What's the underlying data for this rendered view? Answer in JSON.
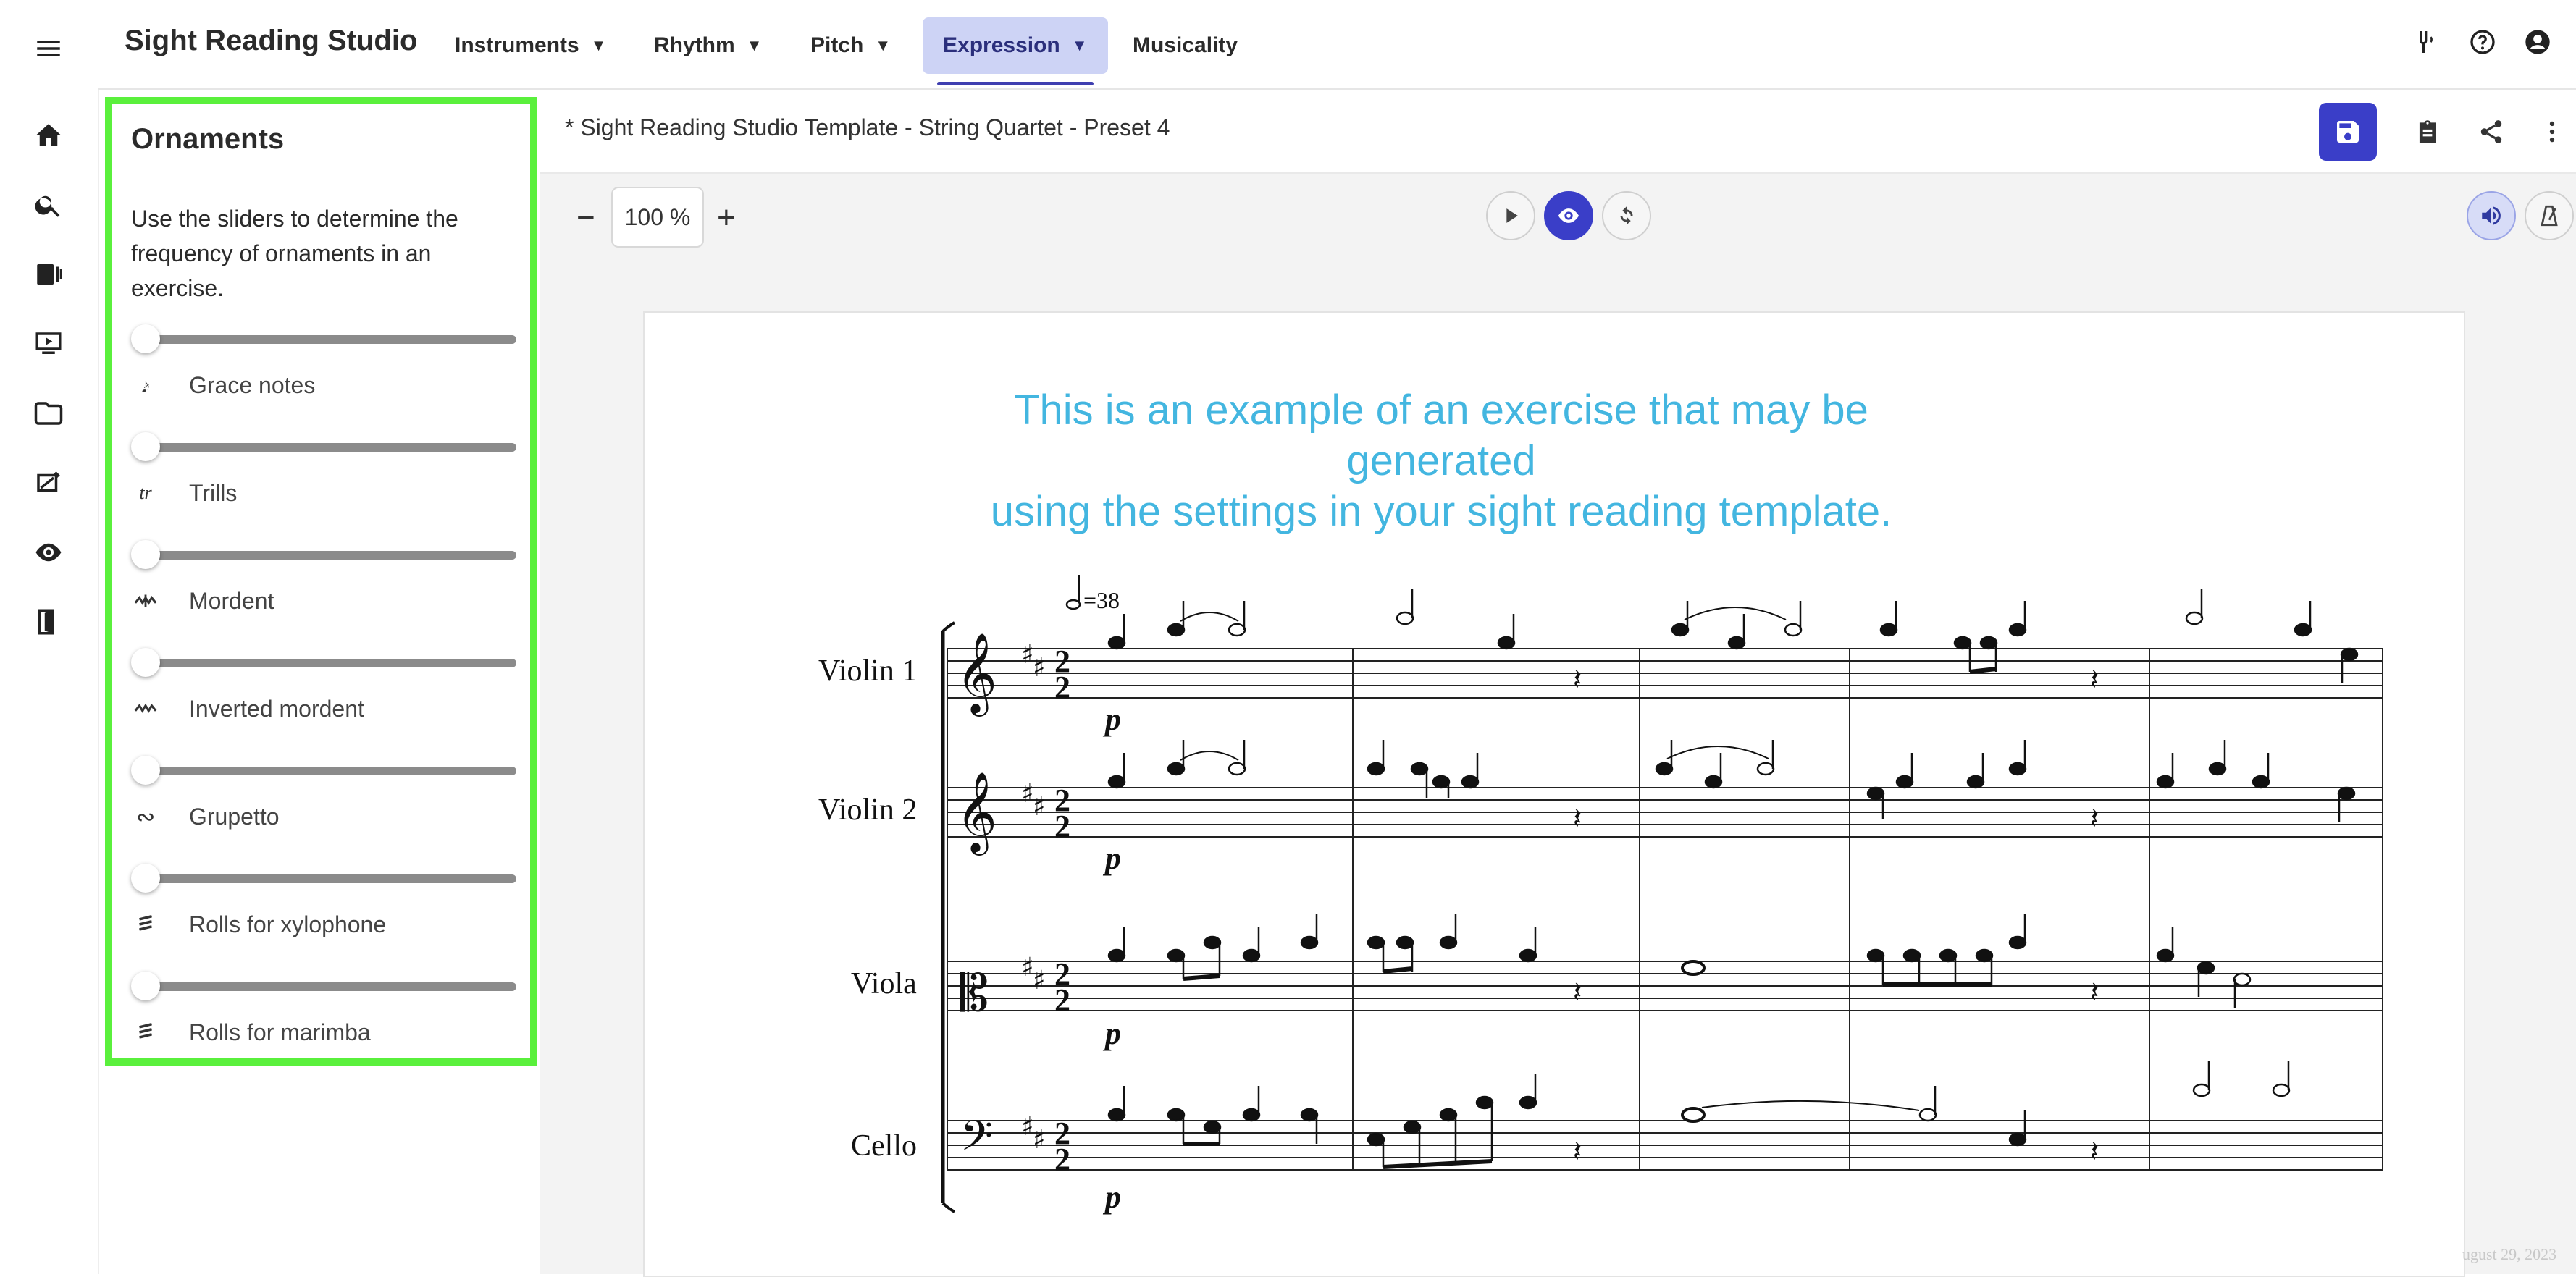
{
  "app": {
    "title": "Sight Reading Studio"
  },
  "nav": {
    "items": [
      {
        "label": "Instruments",
        "has_caret": true
      },
      {
        "label": "Rhythm",
        "has_caret": true
      },
      {
        "label": "Pitch",
        "has_caret": true
      },
      {
        "label": "Expression",
        "has_caret": true,
        "active": true
      },
      {
        "label": "Musicality",
        "has_caret": false
      }
    ]
  },
  "left_rail": {
    "icons": [
      "menu-icon",
      "home-icon",
      "search-icon",
      "library-icon",
      "video-icon",
      "folder-icon",
      "assignment-icon",
      "listen-icon",
      "exit-icon"
    ]
  },
  "panel": {
    "title": "Ornaments",
    "description": "Use the sliders to determine the frequency of ornaments in an exercise.",
    "sliders": [
      {
        "label": "Grace notes",
        "icon": "grace-note-icon",
        "value": 0
      },
      {
        "label": "Trills",
        "icon": "trill-icon",
        "value": 0
      },
      {
        "label": "Mordent",
        "icon": "mordent-icon",
        "value": 0
      },
      {
        "label": "Inverted mordent",
        "icon": "inverted-mordent-icon",
        "value": 0
      },
      {
        "label": "Grupetto",
        "icon": "turn-icon",
        "value": 0
      },
      {
        "label": "Rolls for xylophone",
        "icon": "roll-icon",
        "value": 0
      },
      {
        "label": "Rolls for marimba",
        "icon": "roll-icon",
        "value": 0
      }
    ]
  },
  "document": {
    "title": "* Sight Reading Studio Template - String Quartet - Preset 4"
  },
  "toolbar": {
    "zoom_minus": "−",
    "zoom_value": "100",
    "zoom_unit": "%",
    "zoom_plus": "+"
  },
  "sheet": {
    "caption_line1": "This is an example of an exercise that may be generated",
    "caption_line2": "using the settings in your sight reading template.",
    "tempo": "=38",
    "instruments": [
      "Violin 1",
      "Violin 2",
      "Viola",
      "Cello"
    ],
    "dynamic": "p",
    "date": "ugust 29, 2023"
  },
  "colors": {
    "accent": "#3a3ec8",
    "panel_border": "#5af03c",
    "caption": "#43b6e0",
    "nav_active_bg": "#cdd3f5"
  }
}
